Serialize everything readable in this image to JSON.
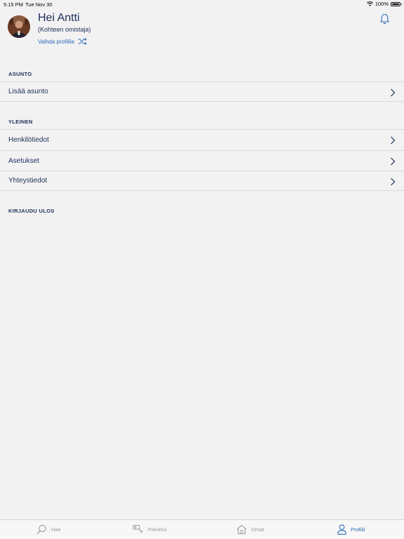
{
  "status_bar": {
    "time": "5:15 PM",
    "date": "Tue Nov 30",
    "battery": "100%"
  },
  "header": {
    "greeting": "Hei Antti",
    "role": "(Kohteen omistaja)",
    "switch_profile": "Vaihda profiilia"
  },
  "sections": {
    "asunto": {
      "title": "ASUNTO",
      "items": [
        {
          "label": "Lisää asunto"
        }
      ]
    },
    "yleinen": {
      "title": "YLEINEN",
      "items": [
        {
          "label": "Henkilötiedot"
        },
        {
          "label": "Asetukset"
        },
        {
          "label": "Yhteystiedot"
        }
      ]
    },
    "logout": {
      "title": "KIRJAUDU ULOS"
    }
  },
  "tabbar": {
    "tabs": [
      {
        "label": "Hae",
        "icon": "search-icon"
      },
      {
        "label": "Palvelut",
        "icon": "key-icon"
      },
      {
        "label": "Omat",
        "icon": "house-icon"
      },
      {
        "label": "Profiili",
        "icon": "person-icon"
      }
    ],
    "active": "Profiili"
  },
  "colors": {
    "background": "#f2f2f2",
    "text_primary": "#1c2f5a",
    "accent": "#2a6ab8",
    "inactive": "#9a9a9a",
    "divider": "#d9d9d9"
  }
}
